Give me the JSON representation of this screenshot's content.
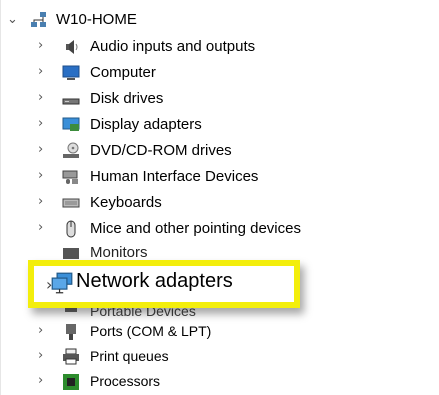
{
  "tree": {
    "root": {
      "label": "W10-HOME",
      "icon": "computer-network-icon",
      "expanded": true
    },
    "items": [
      {
        "label": "Audio inputs and outputs",
        "icon": "speaker-icon"
      },
      {
        "label": "Computer",
        "icon": "monitor-icon"
      },
      {
        "label": "Disk drives",
        "icon": "disk-drive-icon"
      },
      {
        "label": "Display adapters",
        "icon": "display-adapter-icon"
      },
      {
        "label": "DVD/CD-ROM drives",
        "icon": "optical-drive-icon"
      },
      {
        "label": "Human Interface Devices",
        "icon": "hid-icon"
      },
      {
        "label": "Keyboards",
        "icon": "keyboard-icon"
      },
      {
        "label": "Mice and other pointing devices",
        "icon": "mouse-icon"
      },
      {
        "label": "Monitors",
        "icon": "monitor-icon"
      },
      {
        "label": "Network adapters",
        "icon": "network-adapter-icon",
        "highlighted": true
      },
      {
        "label": "Portable Devices",
        "icon": "portable-device-icon"
      },
      {
        "label": "Ports (COM & LPT)",
        "icon": "port-icon"
      },
      {
        "label": "Print queues",
        "icon": "printer-icon"
      },
      {
        "label": "Processors",
        "icon": "processor-icon"
      }
    ]
  },
  "colors": {
    "highlight_border": "#f3ee0c"
  }
}
